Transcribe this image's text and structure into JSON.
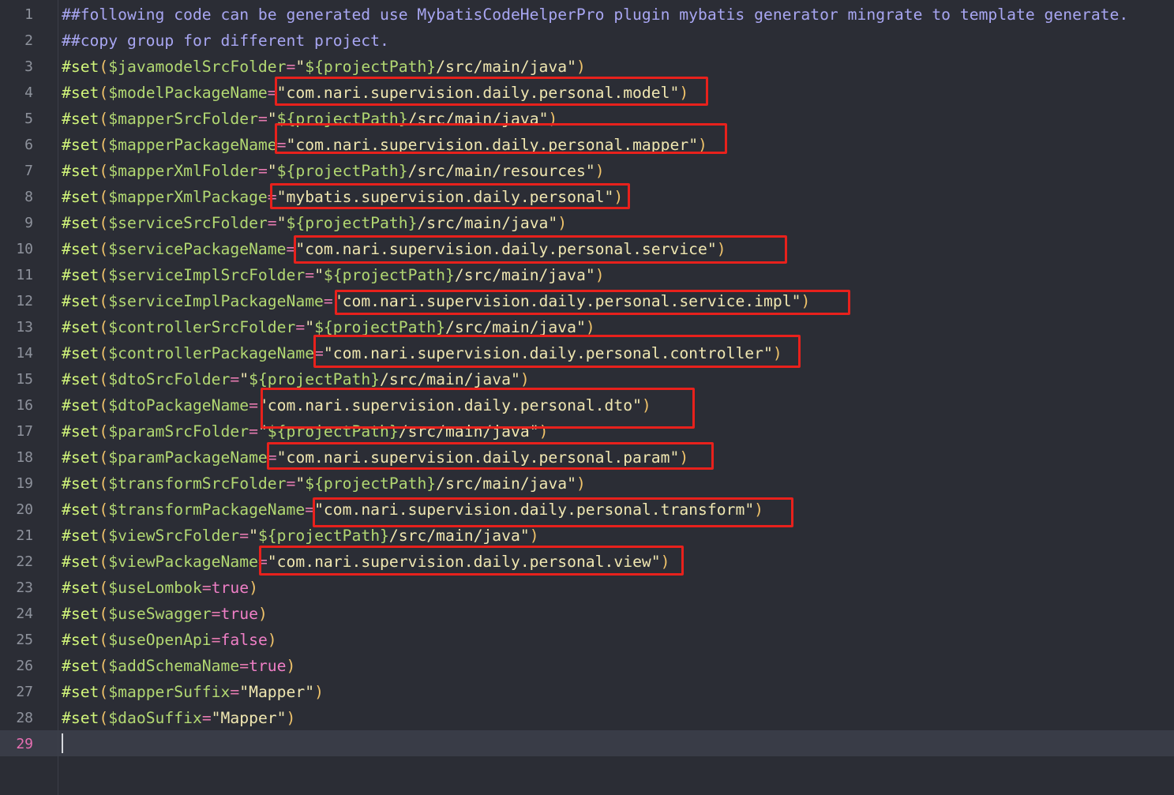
{
  "comments": [
    "##following code can be generated use MybatisCodeHelperPro plugin mybatis generator mingrate to template generate.",
    "##copy group for different project."
  ],
  "code": {
    "keyword": "#set",
    "open": "(",
    "close": ")",
    "eq": "=",
    "quote": "\"",
    "pathVar": "${projectPath}",
    "lines": [
      {
        "var": "$javamodelSrcFolder",
        "type": "path",
        "suffix": "/src/main/java"
      },
      {
        "var": "$modelPackageName",
        "type": "str",
        "value": "com.nari.supervision.daily.personal.model"
      },
      {
        "var": "$mapperSrcFolder",
        "type": "path",
        "suffix": "/src/main/java"
      },
      {
        "var": "$mapperPackageName",
        "type": "str",
        "value": "com.nari.supervision.daily.personal.mapper"
      },
      {
        "var": "$mapperXmlFolder",
        "type": "path",
        "suffix": "/src/main/resources"
      },
      {
        "var": "$mapperXmlPackage",
        "type": "str",
        "value": "mybatis.supervision.daily.personal"
      },
      {
        "var": "$serviceSrcFolder",
        "type": "path",
        "suffix": "/src/main/java"
      },
      {
        "var": "$servicePackageName",
        "type": "str",
        "value": "com.nari.supervision.daily.personal.service"
      },
      {
        "var": "$serviceImplSrcFolder",
        "type": "path",
        "suffix": "/src/main/java"
      },
      {
        "var": "$serviceImplPackageName",
        "type": "str",
        "value": "com.nari.supervision.daily.personal.service.impl"
      },
      {
        "var": "$controllerSrcFolder",
        "type": "path",
        "suffix": "/src/main/java"
      },
      {
        "var": "$controllerPackageName",
        "type": "str",
        "value": "com.nari.supervision.daily.personal.controller"
      },
      {
        "var": "$dtoSrcFolder",
        "type": "path",
        "suffix": "/src/main/java"
      },
      {
        "var": "$dtoPackageName",
        "type": "str",
        "value": "com.nari.supervision.daily.personal.dto"
      },
      {
        "var": "$paramSrcFolder",
        "type": "path",
        "suffix": "/src/main/java"
      },
      {
        "var": "$paramPackageName",
        "type": "str",
        "value": "com.nari.supervision.daily.personal.param"
      },
      {
        "var": "$transformSrcFolder",
        "type": "path",
        "suffix": "/src/main/java"
      },
      {
        "var": "$transformPackageName",
        "type": "str",
        "value": "com.nari.supervision.daily.personal.transform"
      },
      {
        "var": "$viewSrcFolder",
        "type": "path",
        "suffix": "/src/main/java"
      },
      {
        "var": "$viewPackageName",
        "type": "str",
        "value": "com.nari.supervision.daily.personal.view"
      },
      {
        "var": "$useLombok",
        "type": "bool",
        "value": "true"
      },
      {
        "var": "$useSwagger",
        "type": "bool",
        "value": "true"
      },
      {
        "var": "$useOpenApi",
        "type": "bool",
        "value": "false"
      },
      {
        "var": "$addSchemaName",
        "type": "bool",
        "value": "true"
      },
      {
        "var": "$mapperSuffix",
        "type": "str",
        "value": "Mapper"
      },
      {
        "var": "$daoSuffix",
        "type": "str",
        "value": "Mapper"
      }
    ]
  },
  "line_numbers": [
    "1",
    "2",
    "3",
    "4",
    "5",
    "6",
    "7",
    "8",
    "9",
    "10",
    "11",
    "12",
    "13",
    "14",
    "15",
    "16",
    "17",
    "18",
    "19",
    "20",
    "21",
    "22",
    "23",
    "24",
    "25",
    "26",
    "27",
    "28",
    "29"
  ],
  "current_line": "29",
  "highlight_color": "#e8211c"
}
